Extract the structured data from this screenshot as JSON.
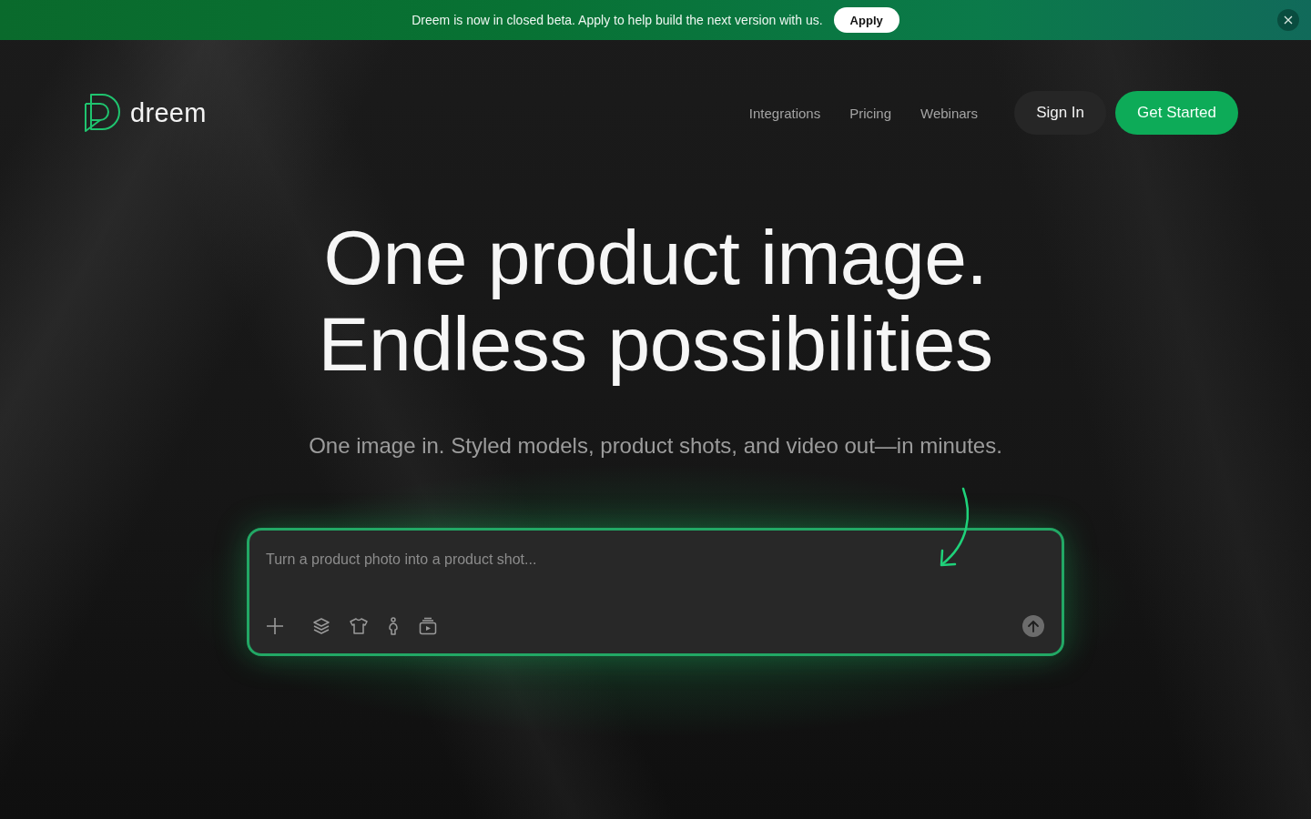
{
  "banner": {
    "message": "Dreem is now in closed beta. Apply to help build the next version with us.",
    "button": "Apply"
  },
  "nav": {
    "logo": "dreem",
    "links": [
      "Integrations",
      "Pricing",
      "Webinars"
    ],
    "buttons": [
      {
        "label": "Sign In",
        "kind": "secondary"
      },
      {
        "label": "Get Started",
        "kind": "primary"
      }
    ]
  },
  "hero": {
    "headline": [
      "One product image.",
      "Endless possibilities"
    ],
    "subtitle": "One image in. Styled models, product shots, and video out—in minutes."
  },
  "prompt": {
    "placeholder": "Turn a product photo into a product shot...",
    "tools": [
      {
        "kind": "add"
      },
      {
        "kind": "layers"
      },
      {
        "kind": "shirt"
      },
      {
        "kind": "model"
      },
      {
        "kind": "video"
      }
    ]
  }
}
